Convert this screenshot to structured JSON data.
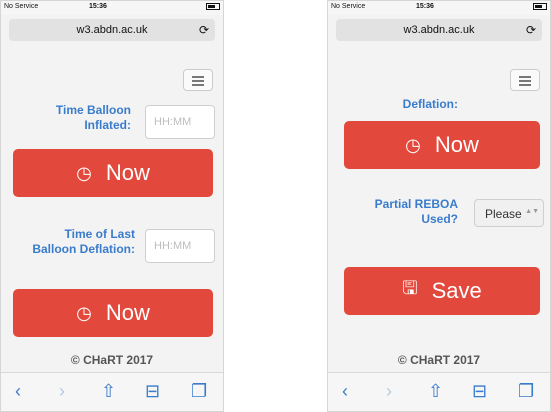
{
  "left_phone": {
    "status": {
      "carrier": "No Service",
      "time": "15:36"
    },
    "url": "w3.abdn.ac.uk",
    "fields": {
      "time_balloon_inflated_label": "Time Balloon Inflated:",
      "time_balloon_inflated_placeholder": "HH:MM",
      "time_last_deflation_label": "Time of Last Balloon Deflation:",
      "time_last_deflation_placeholder": "HH:MM"
    },
    "now_label_1": "Now",
    "now_label_2": "Now",
    "footer": "© CHaRT 2017"
  },
  "right_phone": {
    "status": {
      "carrier": "No Service",
      "time": "15:36"
    },
    "url": "w3.abdn.ac.uk",
    "cut_label": "Deflation:",
    "now_label": "Now",
    "partial_reboa_label": "Partial REBOA Used?",
    "select_value": "Please",
    "save_label": "Save",
    "footer": "© CHaRT 2017"
  },
  "icons": {
    "reload": "reload-icon",
    "menu": "hamburger-menu-icon",
    "timer": "timer-icon",
    "save": "floppy-disk-icon",
    "back": "back-icon",
    "forward": "forward-icon",
    "share": "share-icon",
    "bookmarks": "bookmarks-icon",
    "tabs": "tabs-icon"
  },
  "colors": {
    "accent_red": "#e2483b",
    "label_blue": "#3a7ccc"
  }
}
